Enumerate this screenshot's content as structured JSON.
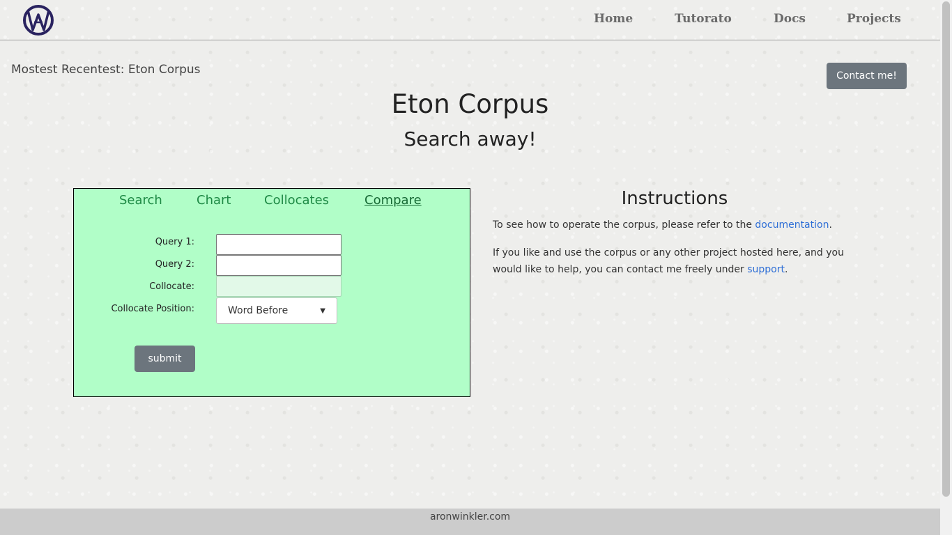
{
  "nav": {
    "logo_icon": "aw-monogram-logo",
    "items": [
      {
        "label": "Home"
      },
      {
        "label": "Tutorato"
      },
      {
        "label": "Docs"
      },
      {
        "label": "Projects"
      }
    ]
  },
  "recent": {
    "label": "Mostest Recentest: Eton Corpus"
  },
  "contact_button": {
    "label": "Contact me!"
  },
  "page": {
    "title": "Eton Corpus",
    "subtitle": "Search away!"
  },
  "search_panel": {
    "tabs": [
      {
        "label": "Search",
        "active": false
      },
      {
        "label": "Chart",
        "active": false
      },
      {
        "label": "Collocates",
        "active": false
      },
      {
        "label": "Compare",
        "active": true
      }
    ],
    "fields": {
      "query1": {
        "label": "Query 1:",
        "value": ""
      },
      "query2": {
        "label": "Query 2:",
        "value": ""
      },
      "collocate": {
        "label": "Collocate:",
        "value": ""
      },
      "position": {
        "label": "Collocate Position:",
        "selected": "Word Before"
      }
    },
    "submit_label": "submit",
    "background_color": "#b1fec8"
  },
  "instructions": {
    "title": "Instructions",
    "p1_before": "To see how to operate the corpus, please refer to the ",
    "p1_link": "documentation",
    "p1_after": ".",
    "p2_before": "If you like and use the corpus or any other project hosted here, and you would like to help, you can contact me freely under ",
    "p2_link": "support",
    "p2_after": ".",
    "link_color": "#2f6fd6"
  },
  "footer": {
    "text": "aronwinkler.com"
  }
}
